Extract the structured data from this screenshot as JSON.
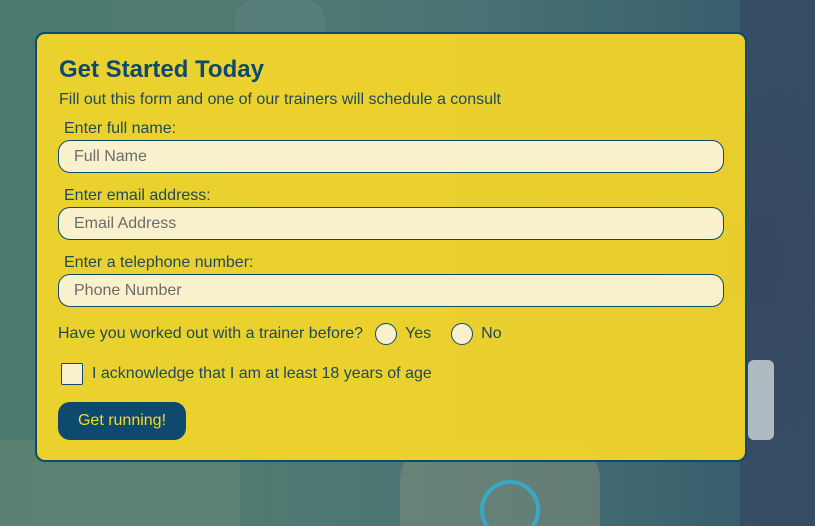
{
  "form": {
    "title": "Get Started Today",
    "subtitle": "Fill out this form and one of our trainers will schedule a consult",
    "name_label": "Enter full name:",
    "name_placeholder": "Full Name",
    "email_label": "Enter email address:",
    "email_placeholder": "Email Address",
    "phone_label": "Enter a telephone number:",
    "phone_placeholder": "Phone Number",
    "trainer_question": "Have you worked out with a trainer before?",
    "option_yes": "Yes",
    "option_no": "No",
    "age_ack": "I acknowledge that I am at least 18 years of age",
    "submit_label": "Get running!"
  },
  "colors": {
    "card_bg": "#f8d828",
    "accent": "#0d4a6e",
    "input_bg": "#f8f1cc"
  }
}
